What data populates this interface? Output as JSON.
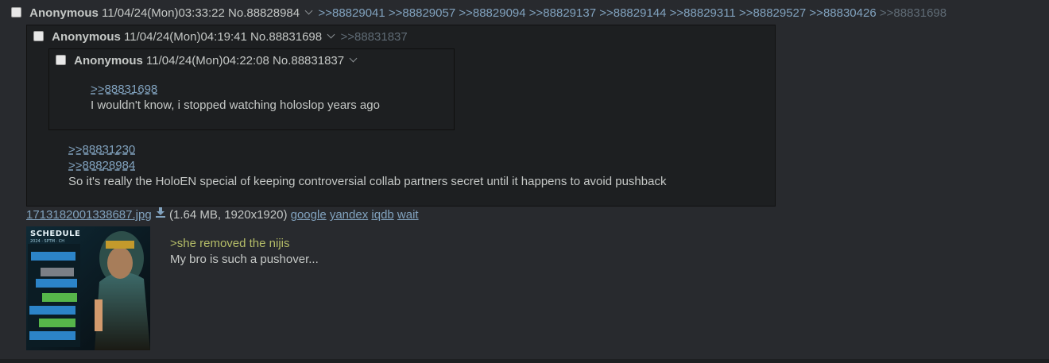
{
  "op": {
    "name": "Anonymous",
    "datetime": "11/04/24(Mon)03:33:22",
    "post_no": "No.88828984",
    "backlinks": [
      ">>88829041",
      ">>88829057",
      ">>88829094",
      ">>88829137",
      ">>88829144",
      ">>88829311",
      ">>88829527",
      ">>88830426"
    ],
    "backlink_dim": ">>88831698"
  },
  "inline1": {
    "name": "Anonymous",
    "datetime": "11/04/24(Mon)04:19:41",
    "post_no": "No.88831698",
    "backlink_dim": ">>88831837",
    "quotes": [
      ">>88831230",
      ">>88828984"
    ],
    "text": "So it's really the HoloEN special of keeping controversial collab partners secret until it happens to avoid pushback"
  },
  "inline2": {
    "name": "Anonymous",
    "datetime": "11/04/24(Mon)04:22:08",
    "post_no": "No.88831837",
    "quote": ">>88831698",
    "text": "I wouldn't know, i stopped watching holoslop years ago"
  },
  "file": {
    "filename": "1713182001338687.jpg",
    "info": "(1.64 MB, 1920x1920)",
    "links": [
      "google",
      "yandex",
      "iqdb",
      "wait"
    ]
  },
  "thumb": {
    "schedule_label": "SCHEDULE",
    "subtitle": "2024 · SPTM · CH"
  },
  "body": {
    "greentext": ">she removed the nijis",
    "text": "My bro is such a pushover..."
  },
  "colors": {
    "background": "#282a2e",
    "inline_bg": "#1d1f21",
    "link": "#81a2be",
    "greentext": "#b5bd68",
    "text": "#c5c8c6"
  }
}
